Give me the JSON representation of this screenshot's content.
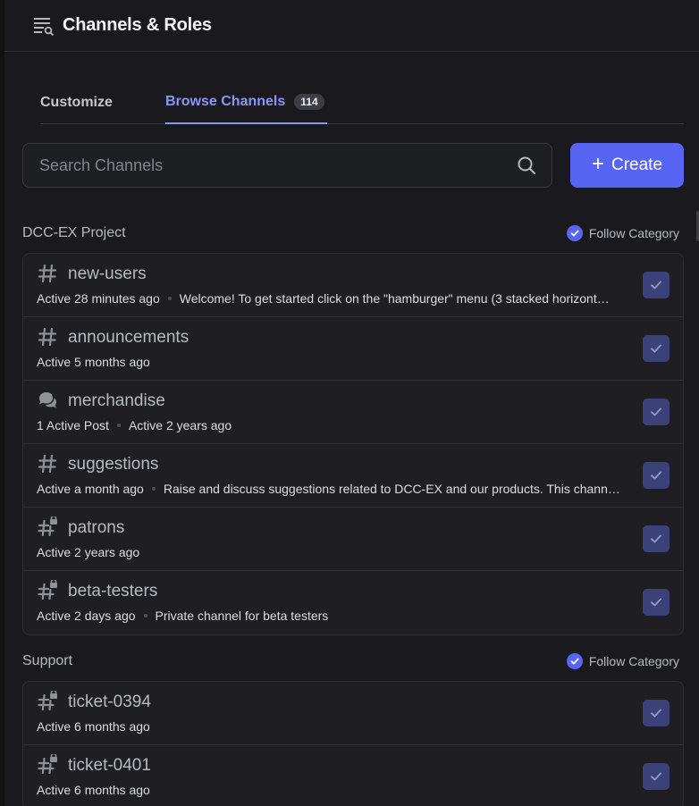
{
  "header": {
    "title": "Channels & Roles",
    "icon": "channel-list-icon"
  },
  "tabs": {
    "customize": "Customize",
    "browse": "Browse Channels",
    "browse_count": "114"
  },
  "search": {
    "placeholder": "Search Channels"
  },
  "create_label": "Create",
  "categories": [
    {
      "name": "DCC-EX Project",
      "follow_label": "Follow Category",
      "channels": [
        {
          "name": "new-users",
          "icon": "hash-icon",
          "activity": "Active 28 minutes ago",
          "topic": "Welcome! To get started click on the \"hamburger\" menu (3 stacked horizont…"
        },
        {
          "name": "announcements",
          "icon": "hash-icon",
          "activity": "Active 5 months ago",
          "topic": ""
        },
        {
          "name": "merchandise",
          "icon": "forum-icon",
          "activity": "1 Active Post",
          "topic": "Active 2 years ago"
        },
        {
          "name": "suggestions",
          "icon": "hash-icon",
          "activity": "Active a month ago",
          "topic": "Raise and discuss suggestions related to DCC-EX and our products. This chann…"
        },
        {
          "name": "patrons",
          "icon": "locked-hash-icon",
          "activity": "Active 2 years ago",
          "topic": ""
        },
        {
          "name": "beta-testers",
          "icon": "locked-hash-icon",
          "activity": "Active 2 days ago",
          "topic": "Private channel for beta testers"
        }
      ]
    },
    {
      "name": "Support",
      "follow_label": "Follow Category",
      "channels": [
        {
          "name": "ticket-0394",
          "icon": "locked-hash-icon",
          "activity": "Active 6 months ago",
          "topic": ""
        },
        {
          "name": "ticket-0401",
          "icon": "locked-hash-icon",
          "activity": "Active 6 months ago",
          "topic": ""
        }
      ]
    }
  ],
  "colors": {
    "accent": "#5865f2",
    "tab_active": "#8b95f5",
    "check_bg": "#3b4279"
  }
}
